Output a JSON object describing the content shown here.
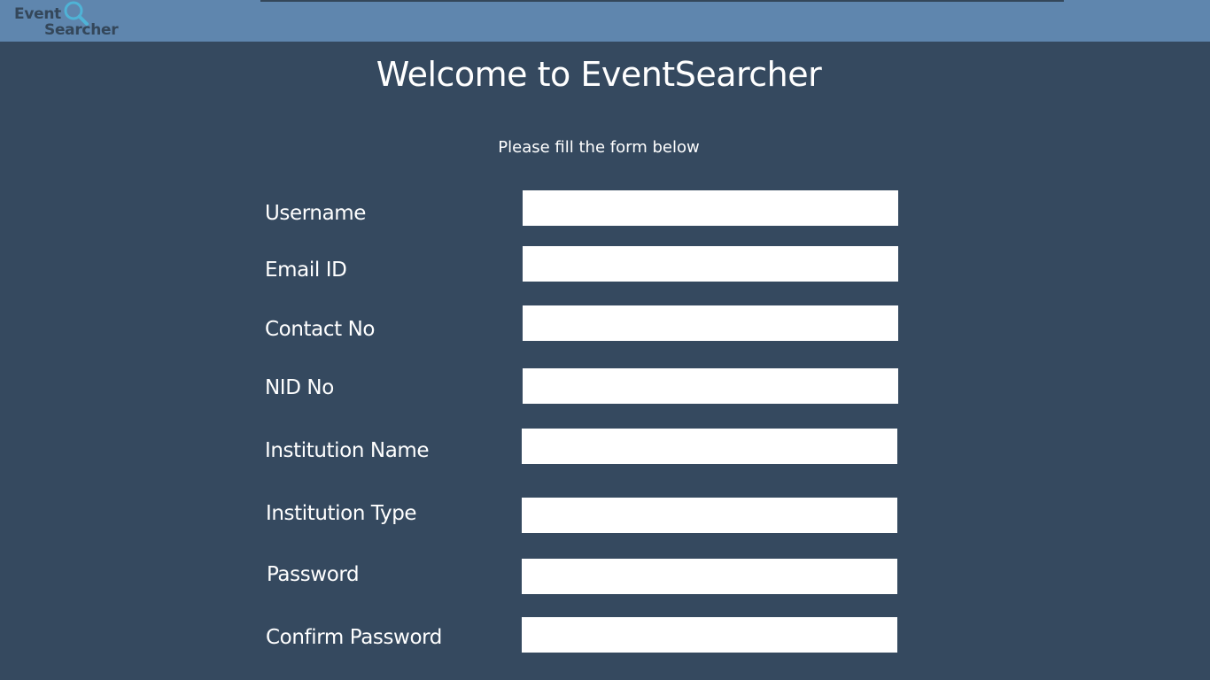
{
  "header": {
    "logo_word_1": "Event",
    "logo_word_2": "Searcher",
    "logo_icon": "magnifier-icon"
  },
  "title": "Welcome to EventSearcher",
  "subtitle": "Please fill the form below",
  "form": {
    "fields": [
      {
        "label": "Username",
        "value": "",
        "placeholder": ""
      },
      {
        "label": "Email ID",
        "value": "",
        "placeholder": ""
      },
      {
        "label": "Contact No",
        "value": "",
        "placeholder": ""
      },
      {
        "label": "NID No",
        "value": "",
        "placeholder": ""
      },
      {
        "label": "Institution Name",
        "value": "",
        "placeholder": ""
      },
      {
        "label": "Institution Type",
        "value": "",
        "placeholder": ""
      },
      {
        "label": "Password",
        "value": "",
        "placeholder": ""
      },
      {
        "label": "Confirm Password",
        "value": "",
        "placeholder": ""
      }
    ]
  },
  "colors": {
    "background": "#35495f",
    "header": "#5f86ae",
    "text": "#ffffff",
    "logo_accent": "#4fb3d6"
  }
}
